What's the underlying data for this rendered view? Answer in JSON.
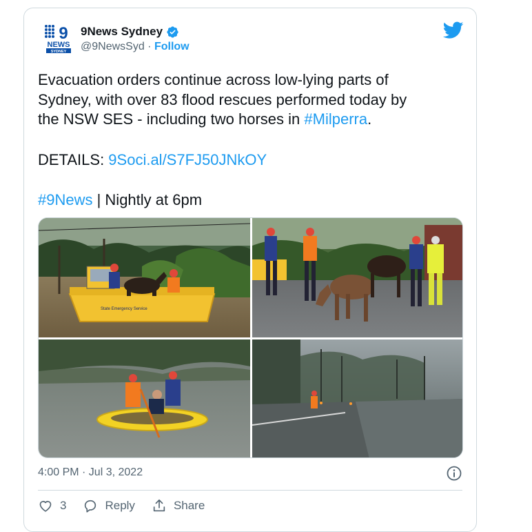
{
  "author": {
    "display_name": "9News Sydney",
    "handle": "@9NewsSyd",
    "separator": "·",
    "follow_label": "Follow",
    "logo_text_top": "9",
    "logo_text_bottom": "NEWS",
    "logo_text_city": "SYDNEY"
  },
  "tweet": {
    "line1": "Evacuation orders continue across low-lying parts of",
    "line2": "Sydney, with over 83 flood rescues performed today by",
    "line3_prefix": "the NSW SES - including two horses in ",
    "line3_hashtag": "#Milperra",
    "line3_suffix": ".",
    "details_label": "DETAILS: ",
    "details_link": "9Soci.al/S7FJ50JNkOY",
    "footer_hashtag": "#9News",
    "footer_text": " | Nightly at 6pm"
  },
  "media": {
    "photo_boat_text": "State Emergency Service"
  },
  "timestamp": "4:00 PM · Jul 3, 2022",
  "actions": {
    "like_count": "3",
    "reply_label": "Reply",
    "share_label": "Share"
  },
  "colors": {
    "accent": "#1d9bf0",
    "secondary_text": "#536471"
  },
  "icons": [
    "nine-news-logo",
    "verified-badge-icon",
    "twitter-bird-icon",
    "info-icon",
    "heart-icon",
    "reply-icon",
    "share-icon"
  ]
}
